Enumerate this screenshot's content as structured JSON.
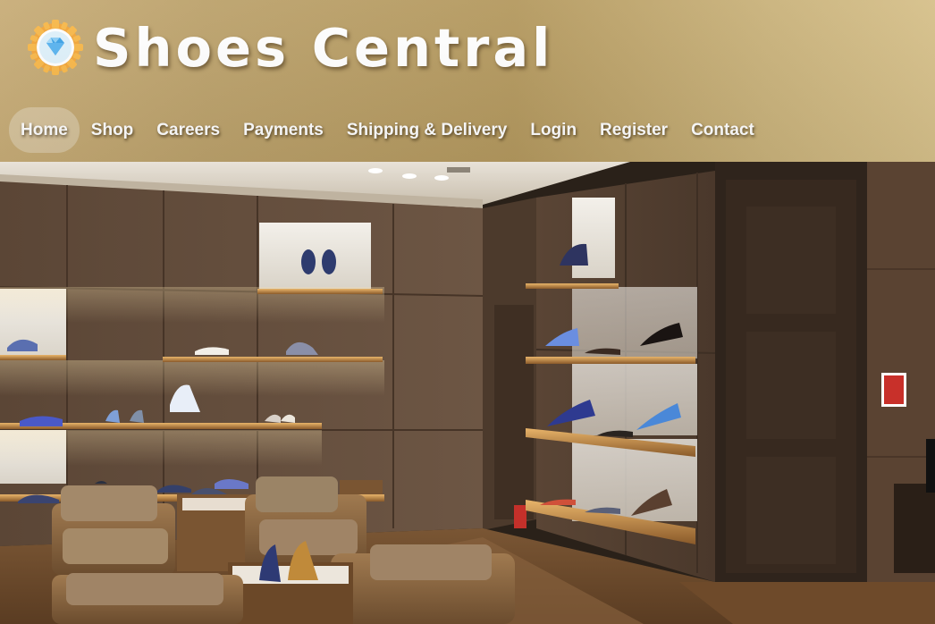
{
  "site": {
    "title": "Shoes Central",
    "logo_icon": "diamond-gear-icon"
  },
  "nav": {
    "items": [
      {
        "label": "Home",
        "active": true
      },
      {
        "label": "Shop",
        "active": false
      },
      {
        "label": "Careers",
        "active": false
      },
      {
        "label": "Payments",
        "active": false
      },
      {
        "label": "Shipping & Delivery",
        "active": false
      },
      {
        "label": "Login",
        "active": false
      },
      {
        "label": "Register",
        "active": false
      },
      {
        "label": "Contact",
        "active": false
      }
    ]
  },
  "hero": {
    "image": "shoe-store-interior-photo"
  },
  "colors": {
    "header_gold": "#bca26c",
    "logo_orange": "#f0a23a",
    "logo_blue": "#5ab4f0",
    "text_white": "#ffffff"
  }
}
